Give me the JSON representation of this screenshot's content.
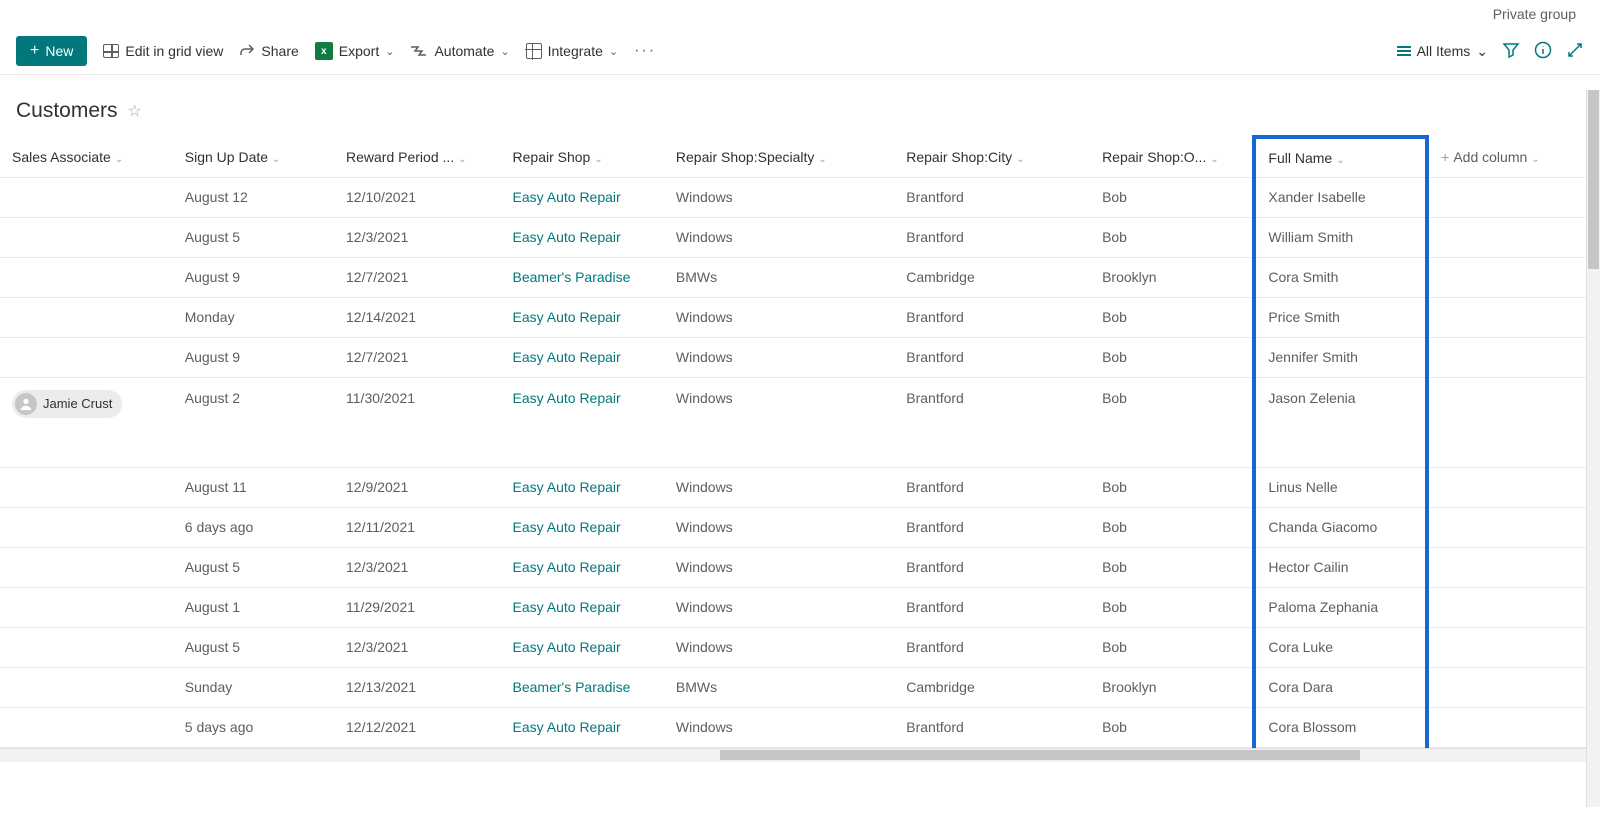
{
  "header": {
    "private_group": "Private group"
  },
  "toolbar": {
    "new": "New",
    "edit_grid": "Edit in grid view",
    "share": "Share",
    "export": "Export",
    "automate": "Automate",
    "integrate": "Integrate",
    "view_name": "All Items"
  },
  "page": {
    "title": "Customers"
  },
  "columns": {
    "sales_associate": "Sales Associate",
    "sign_up_date": "Sign Up Date",
    "reward_period": "Reward Period ...",
    "repair_shop": "Repair Shop",
    "specialty": "Repair Shop:Specialty",
    "city": "Repair Shop:City",
    "owner": "Repair Shop:O...",
    "full_name": "Full Name",
    "add_column": "Add column"
  },
  "rows": [
    {
      "sales_associate": "",
      "sign_up": "August 12",
      "reward": "12/10/2021",
      "shop": "Easy Auto Repair",
      "specialty": "Windows",
      "city": "Brantford",
      "owner": "Bob",
      "full_name": "Xander Isabelle"
    },
    {
      "sales_associate": "",
      "sign_up": "August 5",
      "reward": "12/3/2021",
      "shop": "Easy Auto Repair",
      "specialty": "Windows",
      "city": "Brantford",
      "owner": "Bob",
      "full_name": "William Smith"
    },
    {
      "sales_associate": "",
      "sign_up": "August 9",
      "reward": "12/7/2021",
      "shop": "Beamer's Paradise",
      "specialty": "BMWs",
      "city": "Cambridge",
      "owner": "Brooklyn",
      "full_name": "Cora Smith"
    },
    {
      "sales_associate": "",
      "sign_up": "Monday",
      "reward": "12/14/2021",
      "shop": "Easy Auto Repair",
      "specialty": "Windows",
      "city": "Brantford",
      "owner": "Bob",
      "full_name": "Price Smith"
    },
    {
      "sales_associate": "",
      "sign_up": "August 9",
      "reward": "12/7/2021",
      "shop": "Easy Auto Repair",
      "specialty": "Windows",
      "city": "Brantford",
      "owner": "Bob",
      "full_name": "Jennifer Smith"
    },
    {
      "sales_associate": "Jamie Crust",
      "sign_up": "August 2",
      "reward": "11/30/2021",
      "shop": "Easy Auto Repair",
      "specialty": "Windows",
      "city": "Brantford",
      "owner": "Bob",
      "full_name": "Jason Zelenia",
      "tall": true
    },
    {
      "sales_associate": "",
      "sign_up": "August 11",
      "reward": "12/9/2021",
      "shop": "Easy Auto Repair",
      "specialty": "Windows",
      "city": "Brantford",
      "owner": "Bob",
      "full_name": "Linus Nelle"
    },
    {
      "sales_associate": "",
      "sign_up": "6 days ago",
      "reward": "12/11/2021",
      "shop": "Easy Auto Repair",
      "specialty": "Windows",
      "city": "Brantford",
      "owner": "Bob",
      "full_name": "Chanda Giacomo"
    },
    {
      "sales_associate": "",
      "sign_up": "August 5",
      "reward": "12/3/2021",
      "shop": "Easy Auto Repair",
      "specialty": "Windows",
      "city": "Brantford",
      "owner": "Bob",
      "full_name": "Hector Cailin"
    },
    {
      "sales_associate": "",
      "sign_up": "August 1",
      "reward": "11/29/2021",
      "shop": "Easy Auto Repair",
      "specialty": "Windows",
      "city": "Brantford",
      "owner": "Bob",
      "full_name": "Paloma Zephania"
    },
    {
      "sales_associate": "",
      "sign_up": "August 5",
      "reward": "12/3/2021",
      "shop": "Easy Auto Repair",
      "specialty": "Windows",
      "city": "Brantford",
      "owner": "Bob",
      "full_name": "Cora Luke"
    },
    {
      "sales_associate": "",
      "sign_up": "Sunday",
      "reward": "12/13/2021",
      "shop": "Beamer's Paradise",
      "specialty": "BMWs",
      "city": "Cambridge",
      "owner": "Brooklyn",
      "full_name": "Cora Dara"
    },
    {
      "sales_associate": "",
      "sign_up": "5 days ago",
      "reward": "12/12/2021",
      "shop": "Easy Auto Repair",
      "specialty": "Windows",
      "city": "Brantford",
      "owner": "Bob",
      "full_name": "Cora Blossom"
    }
  ]
}
